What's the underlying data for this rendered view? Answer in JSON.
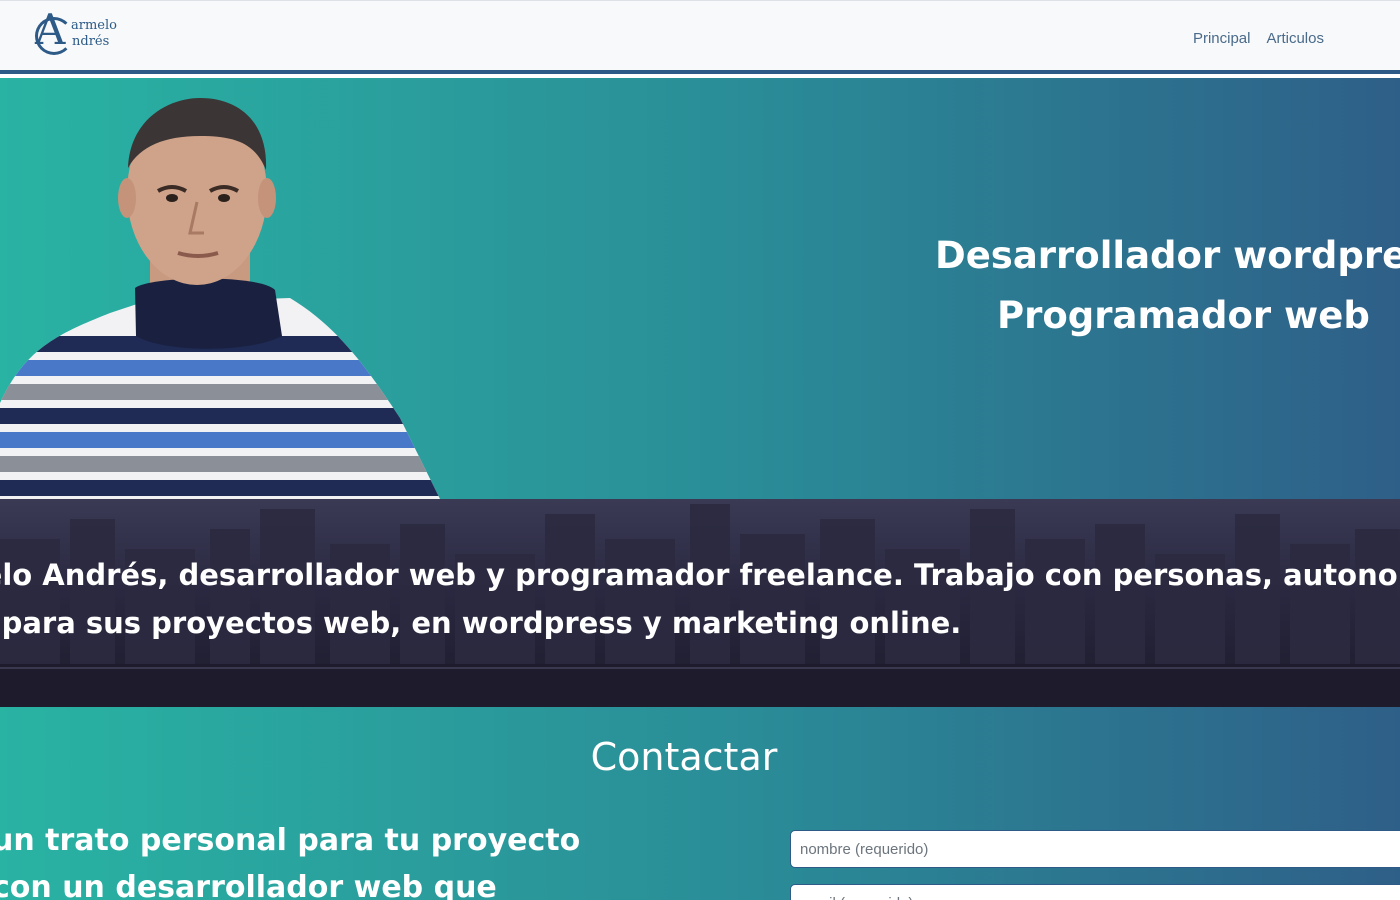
{
  "header": {
    "logo": {
      "initial": "A",
      "line1": "armelo",
      "line2": "ndrés"
    },
    "nav": [
      {
        "label": "Principal"
      },
      {
        "label": "Articulos"
      }
    ]
  },
  "hero": {
    "title_line1": "Desarrollador wordpress",
    "title_line2": "Programador web"
  },
  "intro": {
    "line1": "nelo Andrés, desarrollador web y programador freelance. Trabajo con personas, autonomos y p",
    "line2": "la para sus proyectos web, en wordpress y marketing online."
  },
  "contact": {
    "title": "Contactar",
    "pitch_line1": "un trato personal para tu proyecto",
    "pitch_line2": "con un desarrollador web que",
    "name_placeholder": "nombre (requerido)",
    "email_placeholder": "email (requerido)"
  },
  "colors": {
    "brand": "#2d5a87",
    "gradient_start": "#29b3a3",
    "gradient_end": "#2e5f88",
    "city_dark": "#1c1a2a"
  }
}
